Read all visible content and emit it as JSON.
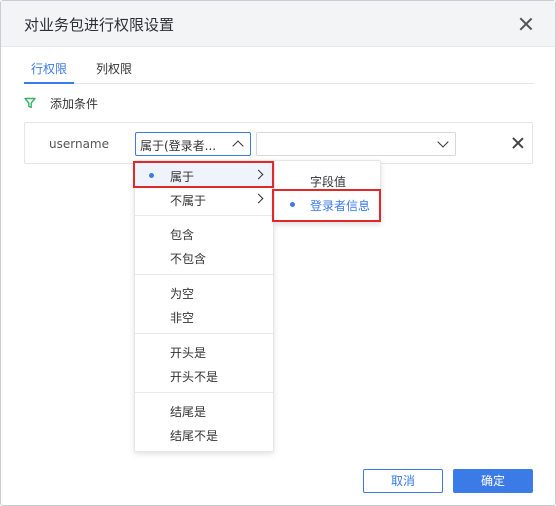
{
  "dialog": {
    "title": "对业务包进行权限设置"
  },
  "tabs": [
    {
      "label": "行权限",
      "active": true
    },
    {
      "label": "列权限",
      "active": false
    }
  ],
  "add_condition": {
    "label": "添加条件",
    "icon": "funnel-icon",
    "icon_color": "#3ab06a"
  },
  "condition": {
    "field": "username",
    "operator_display": "属于(登录者...",
    "value": ""
  },
  "operator_menu": {
    "groups": [
      [
        {
          "label": "属于",
          "selected": true,
          "has_submenu": true
        },
        {
          "label": "不属于",
          "selected": false,
          "has_submenu": true
        }
      ],
      [
        {
          "label": "包含"
        },
        {
          "label": "不包含"
        }
      ],
      [
        {
          "label": "为空"
        },
        {
          "label": "非空"
        }
      ],
      [
        {
          "label": "开头是"
        },
        {
          "label": "开头不是"
        }
      ],
      [
        {
          "label": "结尾是"
        },
        {
          "label": "结尾不是"
        }
      ]
    ]
  },
  "sub_menu": {
    "items": [
      {
        "label": "字段值",
        "selected": false
      },
      {
        "label": "登录者信息",
        "selected": true
      }
    ]
  },
  "footer": {
    "cancel_label": "取消",
    "ok_label": "确定"
  },
  "colors": {
    "accent": "#3b7be8",
    "highlight": "#e02a2a"
  }
}
